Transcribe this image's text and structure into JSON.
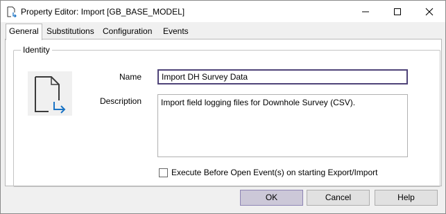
{
  "window": {
    "title": "Property Editor: Import [GB_BASE_MODEL]",
    "icons": {
      "app": "document-arrow-icon",
      "minimize": "minimize-icon",
      "maximize": "maximize-icon",
      "close": "close-icon"
    }
  },
  "tabs": [
    {
      "label": "General",
      "active": true
    },
    {
      "label": "Substitutions",
      "active": false
    },
    {
      "label": "Configuration",
      "active": false
    },
    {
      "label": "Events",
      "active": false
    }
  ],
  "identity": {
    "group_label": "Identity",
    "icon": "import-document-icon",
    "name_label": "Name",
    "name_value": "Import DH Survey Data",
    "description_label": "Description",
    "description_value": "Import field logging files for Downhole Survey (CSV).",
    "execute_checkbox": {
      "label": "Execute Before Open Event(s) on starting Export/Import",
      "checked": false
    }
  },
  "buttons": {
    "ok": "OK",
    "cancel": "Cancel",
    "help": "Help"
  },
  "colors": {
    "focus_border": "#4e4378",
    "ok_button": "#ccc8d8",
    "arrow": "#1a73c4"
  }
}
